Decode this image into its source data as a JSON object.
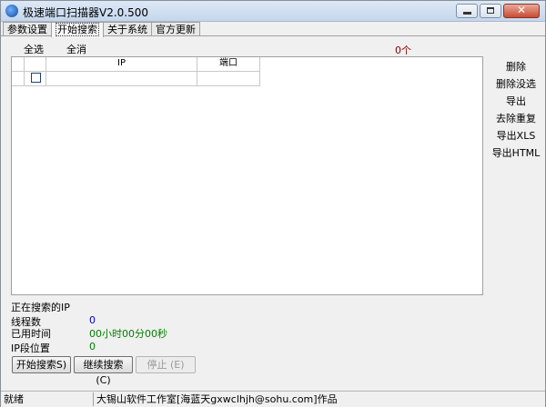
{
  "window": {
    "title": "极速端口扫描器V2.0.500"
  },
  "tabs": [
    {
      "label": "参数设置"
    },
    {
      "label": "开始搜索"
    },
    {
      "label": "关于系统"
    },
    {
      "label": "官方更新"
    }
  ],
  "panel": {
    "select_all": "全选",
    "select_none": "全消",
    "count": "0个"
  },
  "table": {
    "columns": [
      "",
      "IP",
      "端口"
    ],
    "rows": [
      {
        "ip": "",
        "port": ""
      }
    ]
  },
  "side_actions": [
    "删除",
    "删除没选",
    "导出",
    "去除重复",
    "导出XLS",
    "导出HTML"
  ],
  "info": {
    "searching_label": "正在搜索的IP",
    "searching_value": "",
    "threads_label": "线程数",
    "threads_value": "0",
    "elapsed_label": "已用时间",
    "elapsed_value": "00小时00分00秒",
    "ip_pos_label": "IP段位置",
    "ip_pos_value": "0"
  },
  "buttons": {
    "start": "开始搜索S)",
    "continue": "继续搜索 (C)",
    "stop": "停止 (E)"
  },
  "statusbar": {
    "state": "就绪",
    "credit": "大锡山软件工作室[海蓝天gxwclhjh@sohu.com]作品"
  }
}
